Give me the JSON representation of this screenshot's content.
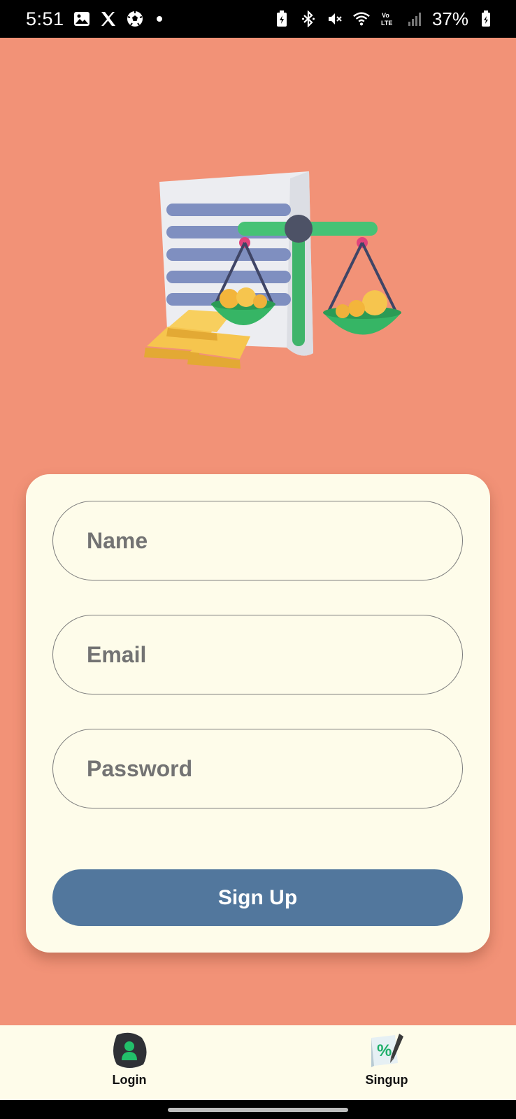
{
  "status_bar": {
    "time": "5:51",
    "battery": "37%",
    "left_icons": [
      "gallery-icon",
      "x-icon",
      "soccer-ball-icon",
      "notification-dot-icon"
    ],
    "right_icons": [
      "battery-saver-icon",
      "bluetooth-icon",
      "vibrate-mute-icon",
      "wifi-icon",
      "volte-icon",
      "signal-icon",
      "battery-icon"
    ]
  },
  "hero": {
    "illustration": "finance-scale-document-gold-illustration"
  },
  "form": {
    "name_placeholder": "Name",
    "email_placeholder": "Email",
    "password_placeholder": "Password",
    "signup_label": "Sign Up"
  },
  "bottom_nav": {
    "items": [
      {
        "label": "Login",
        "icon": "login-user-icon"
      },
      {
        "label": "Singup",
        "icon": "signup-percent-icon"
      }
    ]
  },
  "colors": {
    "background": "#F29277",
    "card": "#FEFCEA",
    "button": "#52779D",
    "nav": "#FEFCEA"
  }
}
